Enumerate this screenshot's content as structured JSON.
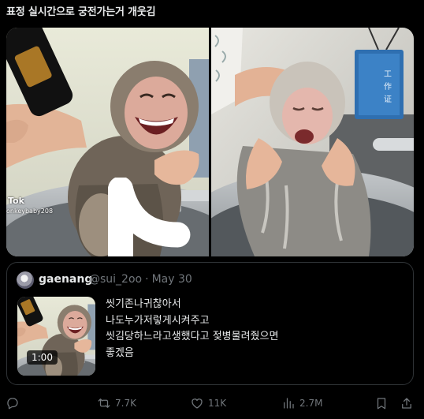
{
  "post": {
    "text": "표정 실시간으로 궁전가는거 개웃김"
  },
  "media": {
    "left": {
      "watermark_icon": "tiktok-logo-icon",
      "watermark_brand": "Tok",
      "watermark_user": "onkeybaby208"
    },
    "right": {
      "sign_text": [
        "工",
        "作",
        "证"
      ]
    }
  },
  "quote": {
    "avatar_icon": "avatar",
    "name": "gaenang",
    "handle": "@sui_2oo",
    "separator": "·",
    "date": "May 30",
    "video_duration": "1:00",
    "lines": [
      "씻기존나귀찮아서",
      "나도누가저렇게시켜주고",
      "씻김당하느라고생했다고 젖병물려줬으면",
      "좋겠음"
    ]
  },
  "actions": {
    "reply": {
      "icon": "reply-icon"
    },
    "retweet": {
      "icon": "retweet-icon",
      "count": "7.7K"
    },
    "like": {
      "icon": "heart-icon",
      "count": "11K"
    },
    "views": {
      "icon": "views-chart-icon",
      "count": "2.7M"
    },
    "bookmark": {
      "icon": "bookmark-icon"
    },
    "share": {
      "icon": "share-icon"
    }
  },
  "colors": {
    "background": "#000000",
    "text": "#e7e9ea",
    "muted": "#71767b",
    "border": "#2f3336",
    "sign_blue": "#2f6fb0"
  }
}
